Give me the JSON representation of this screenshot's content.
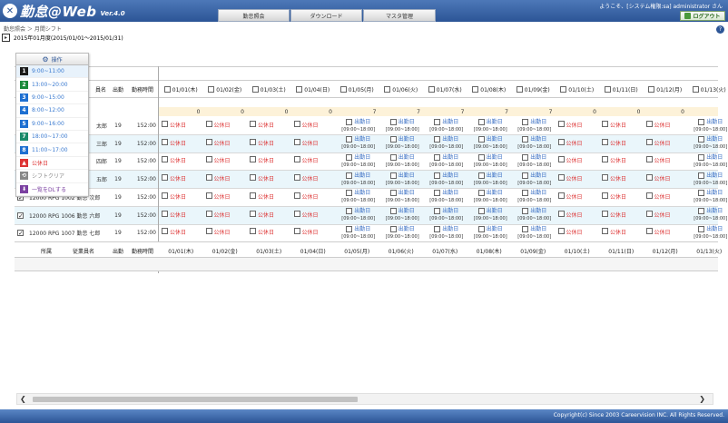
{
  "header": {
    "logo_text": "勤怠@Web",
    "version": "Ver.4.0",
    "nav": [
      "勤怠照会",
      "ダウンロード",
      "マスタ管理"
    ],
    "welcome": "ようこそ、[システム権限:sa] administrator さん",
    "logout_label": "ログアウト"
  },
  "breadcrumb": "勤怠照会 ＞ 月間シフト",
  "period": "2015年01月度(2015/01/01～2015/01/31)",
  "columns": {
    "emp_name": "員名",
    "attendance": "出勤",
    "work_hours": "勤務時間",
    "foot_dept": "所属",
    "foot_emp": "従業員名",
    "foot_attendance": "出勤",
    "foot_work_hours": "勤務時間"
  },
  "dates": [
    "01/01(木)",
    "01/02(金)",
    "01/03(土)",
    "01/04(日)",
    "01/05(月)",
    "01/06(火)",
    "01/07(水)",
    "01/08(木)",
    "01/09(金)",
    "01/10(土)",
    "01/11(日)",
    "01/12(月)",
    "01/13(火)"
  ],
  "foot_dates": [
    "01/01(木)",
    "01/02(金)",
    "01/03(土)",
    "01/04(日)",
    "01/05(月)",
    "01/06(火)",
    "01/07(水)",
    "01/08(木)",
    "01/09(金)",
    "01/10(土)",
    "01/11(日)",
    "01/12(月)",
    "01/13(火)"
  ],
  "counts": [
    "0",
    "0",
    "0",
    "0",
    "7",
    "7",
    "7",
    "7",
    "7",
    "0",
    "0",
    "0"
  ],
  "labels": {
    "holiday": "公休日",
    "workday": "出勤日",
    "work_time": "[09:00~18:00]"
  },
  "rows": [
    {
      "name": "太郎",
      "attendance": "19",
      "hours": "152:00",
      "checked": false,
      "full": ""
    },
    {
      "name": "三郎",
      "attendance": "19",
      "hours": "152:00",
      "checked": false,
      "full": ""
    },
    {
      "name": "四郎",
      "attendance": "19",
      "hours": "152:00",
      "checked": false,
      "full": ""
    },
    {
      "name": "五郎",
      "attendance": "19",
      "hours": "152:00",
      "checked": false,
      "full": ""
    },
    {
      "name": "",
      "attendance": "19",
      "hours": "152:00",
      "checked": true,
      "full": "12000 RPG 1002 勤怠 次郎"
    },
    {
      "name": "",
      "attendance": "19",
      "hours": "152:00",
      "checked": true,
      "full": "12000 RPG 1006 勤怠 六郎"
    },
    {
      "name": "",
      "attendance": "19",
      "hours": "152:00",
      "checked": true,
      "full": "12000 RPG 1007 勤怠 七郎"
    }
  ],
  "menu": {
    "button_label": "操作",
    "items": [
      {
        "badge": "1",
        "label": "9:00~11:00",
        "color": "#1a1a1a"
      },
      {
        "badge": "2",
        "label": "13:00~20:00",
        "color": "#1a8a3a"
      },
      {
        "badge": "3",
        "label": "9:00~15:00",
        "color": "#1d6fd1"
      },
      {
        "badge": "4",
        "label": "8:00~12:00",
        "color": "#1d6fd1"
      },
      {
        "badge": "5",
        "label": "9:00~16:00",
        "color": "#1d6fd1"
      },
      {
        "badge": "7",
        "label": "18:00~17:00",
        "color": "#1a8a6a"
      },
      {
        "badge": "8",
        "label": "11:00~17:00",
        "color": "#1d6fd1"
      },
      {
        "badge": "▲",
        "label": "公休日",
        "color": "#d33"
      },
      {
        "badge": "⟲",
        "label": "シフトクリア",
        "color": "#888"
      },
      {
        "badge": "⬇",
        "label": "一覧をDLする",
        "color": "#7a3fa0"
      }
    ]
  },
  "footer": {
    "copyright": "Copyright(c) Since 2003 Careervision INC. All Rights Reserved."
  }
}
